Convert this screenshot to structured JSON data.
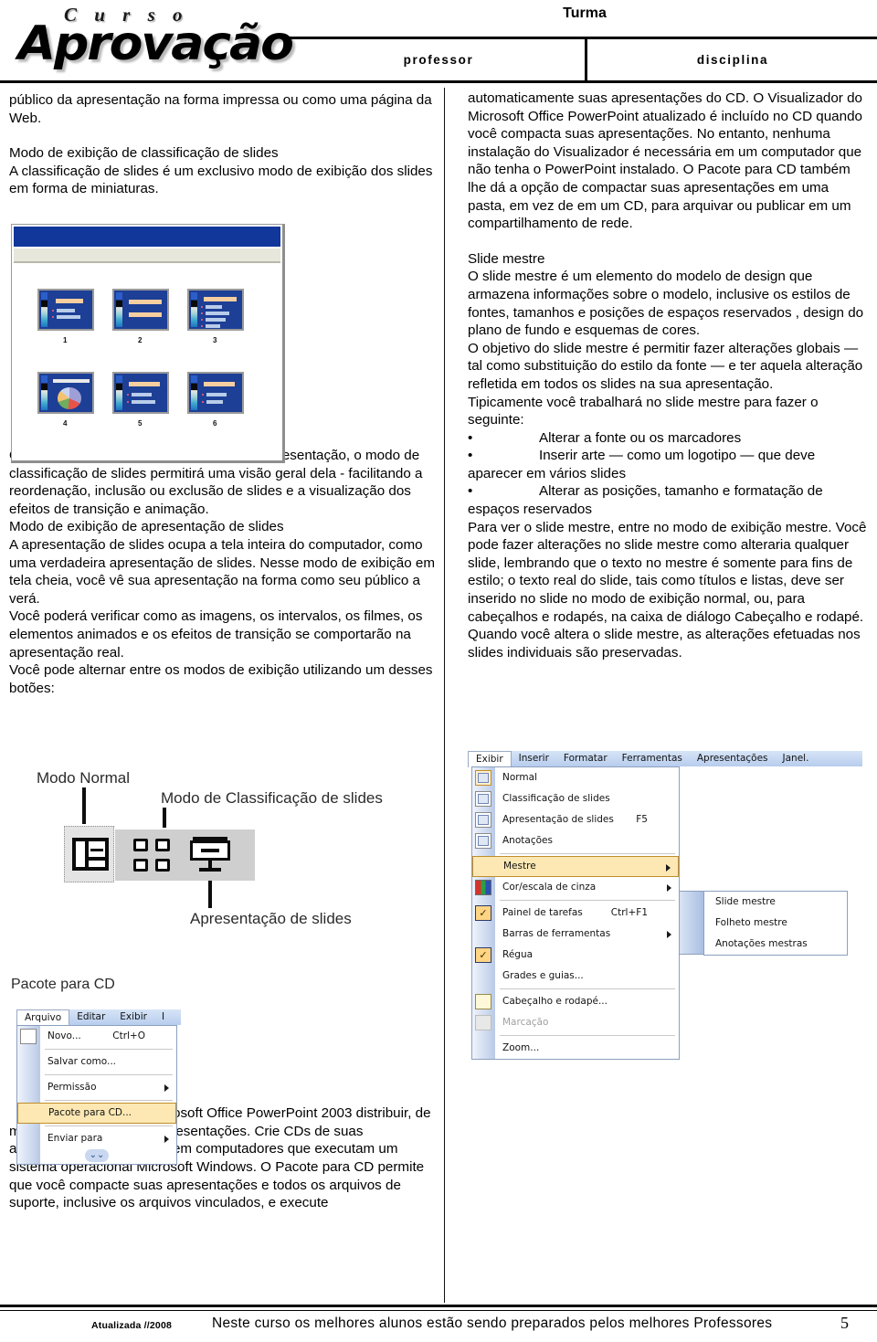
{
  "header": {
    "logo_top": "C u r s o",
    "logo_main": "Aprovação",
    "turma": "Turma",
    "professor": "professor",
    "disciplina": "disciplina"
  },
  "left_column": {
    "p1": "público da apresentação na forma impressa ou como uma página da Web.",
    "h1": "Modo de exibição de classificação de slides",
    "p2": "A classificação de slides é um exclusivo modo de exibição dos slides em forma de miniaturas.",
    "p3": "Quando você terminar de criar e editar a apresentação, o modo de classificação de slides permitirá uma visão geral dela - facilitando a reordenação, inclusão ou exclusão de slides e a visualização dos efeitos de transição e animação.",
    "h2": "Modo de exibição de apresentação de slides",
    "p4": "A apresentação de slides ocupa a tela inteira do computador, como uma verdadeira apresentação de slides. Nesse modo de exibição em tela cheia, você vê sua apresentação na forma como seu público a verá.",
    "p5": "Você poderá verificar como as imagens, os intervalos, os filmes, os elementos animados e os efeitos de transição se comportarão na apresentação real.",
    "p6": "Você pode alternar entre os modos de exibição utilizando um desses botões:",
    "pacote_heading": "Pacote para CD",
    "p7": "É uma maneira do Microsoft Office PowerPoint 2003 distribuir, de maneira eficiente, suas apresentações. Crie CDs de suas apresentações para exibir em computadores que executam um sistema operacional Microsoft Windows. O Pacote para CD permite que você compacte suas apresentações e todos os arquivos de suporte, inclusive os arquivos vinculados, e execute"
  },
  "right_column": {
    "p1": "automaticamente suas apresentações do CD. O Visualizador do Microsoft Office PowerPoint atualizado é incluído no CD quando você compacta suas apresentações. No entanto, nenhuma instalação do Visualizador é necessária em um computador que não tenha o PowerPoint instalado. O Pacote para CD também lhe dá a opção de compactar suas apresentações em uma pasta, em vez de em um CD, para arquivar ou publicar em um compartilhamento de rede.",
    "h1": "Slide mestre",
    "p2": "O slide mestre é um elemento do modelo de design que armazena informações sobre o modelo, inclusive os estilos de fontes, tamanhos e posições de espaços reservados , design do plano de fundo e esquemas de cores.",
    "p3": "O objetivo do slide mestre é permitir fazer alterações globais — tal como substituição do estilo da fonte — e ter aquela alteração refletida em todos os slides na sua apresentação.",
    "p4": "Tipicamente você trabalhará no slide mestre para fazer o seguinte:",
    "bullets": [
      "Alterar a fonte ou os marcadores",
      "Inserir arte — como um logotipo — que deve aparecer em vários slides",
      "Alterar as posições, tamanho e formatação de espaços reservados"
    ],
    "bullet_char": "•",
    "p5": "Para ver o slide mestre, entre no modo de exibição mestre. Você pode fazer alterações no slide mestre como alteraria qualquer slide, lembrando que o texto no mestre é somente para fins de estilo; o texto real do slide, tais como títulos e listas, deve ser inserido no slide no modo de exibição normal, ou, para cabeçalhos e rodapés, na caixa de diálogo Cabeçalho e rodapé.",
    "p6": "Quando você altera o slide mestre, as alterações efetuadas nos slides individuais são preservadas."
  },
  "view_buttons_figure": {
    "label_normal": "Modo Normal",
    "label_sorter": "Modo de Classificação de slides",
    "label_show": "Apresentação de slides"
  },
  "slide_sorter_figure": {
    "slide_numbers": [
      "1",
      "2",
      "3",
      "4",
      "5",
      "6"
    ],
    "titlebar_color": "#11379b",
    "thumb_color": "#1d3f96"
  },
  "menu_arquivo": {
    "menubar": [
      "Arquivo",
      "Editar",
      "Exibir",
      "I"
    ],
    "selected": "Arquivo",
    "items": [
      {
        "label": "Novo...",
        "shortcut": "Ctrl+O",
        "icon": "new-document-icon",
        "arrow": false,
        "highlighted": false
      },
      {
        "label": "Salvar como...",
        "shortcut": "",
        "icon": "",
        "arrow": false,
        "highlighted": false
      },
      {
        "label": "Permissão",
        "shortcut": "",
        "icon": "",
        "arrow": true,
        "highlighted": false
      },
      {
        "label": "Pacote para CD...",
        "shortcut": "",
        "icon": "",
        "arrow": false,
        "highlighted": true
      },
      {
        "label": "Enviar para",
        "shortcut": "",
        "icon": "",
        "arrow": true,
        "highlighted": false
      }
    ],
    "expand_chevron": "⌄⌄"
  },
  "menu_exibir": {
    "menubar": [
      "Exibir",
      "Inserir",
      "Formatar",
      "Ferramentas",
      "Apresentações",
      "Janel."
    ],
    "selected": "Exibir",
    "items": [
      {
        "label": "Normal",
        "shortcut": "",
        "icon": "normal-view-icon",
        "arrow": false,
        "highlighted": false,
        "dim": false
      },
      {
        "label": "Classificação de slides",
        "shortcut": "",
        "icon": "slide-sorter-icon",
        "arrow": false,
        "highlighted": false,
        "dim": false
      },
      {
        "label": "Apresentação de slides",
        "shortcut": "F5",
        "icon": "slide-show-icon",
        "arrow": false,
        "highlighted": false,
        "dim": false
      },
      {
        "label": "Anotações",
        "shortcut": "",
        "icon": "notes-page-icon",
        "arrow": false,
        "highlighted": false,
        "dim": false
      },
      {
        "label": "Mestre",
        "shortcut": "",
        "icon": "",
        "arrow": true,
        "highlighted": true,
        "dim": false
      },
      {
        "label": "Cor/escala de cinza",
        "shortcut": "",
        "icon": "color-grayscale-icon",
        "arrow": true,
        "highlighted": false,
        "dim": false
      },
      {
        "label": "Painel de tarefas",
        "shortcut": "Ctrl+F1",
        "icon": "checkmark-icon",
        "arrow": false,
        "highlighted": false,
        "dim": false
      },
      {
        "label": "Barras de ferramentas",
        "shortcut": "",
        "icon": "",
        "arrow": true,
        "highlighted": false,
        "dim": false
      },
      {
        "label": "Régua",
        "shortcut": "",
        "icon": "checkmark-icon",
        "arrow": false,
        "highlighted": false,
        "dim": false
      },
      {
        "label": "Grades e guias...",
        "shortcut": "",
        "icon": "",
        "arrow": false,
        "highlighted": false,
        "dim": false
      },
      {
        "label": "Cabeçalho e rodapé...",
        "shortcut": "",
        "icon": "header-footer-icon",
        "arrow": false,
        "highlighted": false,
        "dim": false
      },
      {
        "label": "Marcação",
        "shortcut": "",
        "icon": "markup-icon",
        "arrow": false,
        "highlighted": false,
        "dim": true
      },
      {
        "label": "Zoom...",
        "shortcut": "",
        "icon": "",
        "arrow": false,
        "highlighted": false,
        "dim": false
      }
    ],
    "submenu": [
      {
        "label": "Slide mestre"
      },
      {
        "label": "Folheto mestre"
      },
      {
        "label": "Anotações mestras"
      }
    ]
  },
  "footer": {
    "date": "Atualizada //2008",
    "slogan": "Neste curso os melhores alunos estão sendo preparados pelos melhores Professores",
    "page": "5"
  }
}
